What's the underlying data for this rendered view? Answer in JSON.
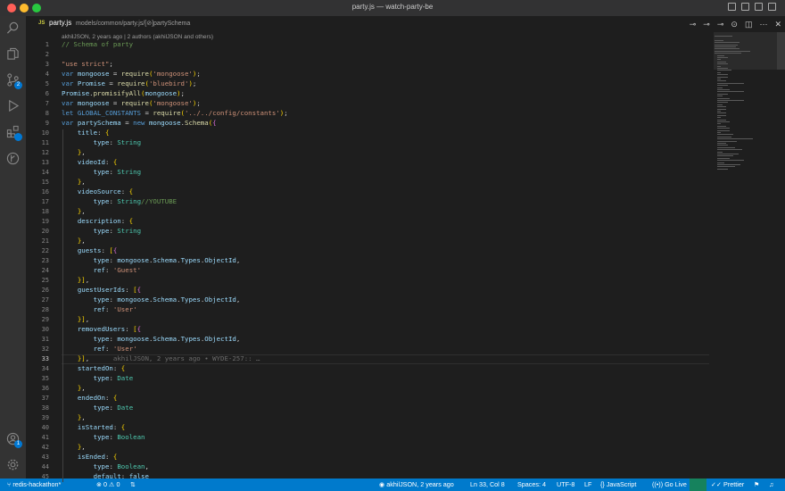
{
  "window": {
    "title": "party.js — watch-party-be"
  },
  "tab": {
    "lang": "JS",
    "filename": "party.js",
    "breadcrumb": "models/common/party.js/[⊘]partySchema"
  },
  "blame_header": "akhilJSON, 2 years ago | 2 authors (akhilJSON and others)",
  "activity_badges": {
    "scm": "2",
    "account": "1"
  },
  "code_lines": [
    {
      "n": "1",
      "text": "// Schema of party"
    },
    {
      "n": "2",
      "text": ""
    },
    {
      "n": "3",
      "text": "\"use strict\";"
    },
    {
      "n": "4",
      "text": "var mongoose = require('mongoose');"
    },
    {
      "n": "5",
      "text": "var Promise = require('bluebird');"
    },
    {
      "n": "6",
      "text": "Promise.promisifyAll(mongoose);"
    },
    {
      "n": "7",
      "text": "var mongoose = require('mongoose');"
    },
    {
      "n": "8",
      "text": "let GLOBAL_CONSTANTS = require('../../config/constants');"
    },
    {
      "n": "9",
      "text": "var partySchema = new mongoose.Schema({"
    },
    {
      "n": "10",
      "text": "    title: {"
    },
    {
      "n": "11",
      "text": "        type: String"
    },
    {
      "n": "12",
      "text": "    },"
    },
    {
      "n": "13",
      "text": "    videoId: {"
    },
    {
      "n": "14",
      "text": "        type: String"
    },
    {
      "n": "15",
      "text": "    },"
    },
    {
      "n": "16",
      "text": "    videoSource: {"
    },
    {
      "n": "17",
      "text": "        type: String//YOUTUBE"
    },
    {
      "n": "18",
      "text": "    },"
    },
    {
      "n": "19",
      "text": "    description: {"
    },
    {
      "n": "20",
      "text": "        type: String"
    },
    {
      "n": "21",
      "text": "    },"
    },
    {
      "n": "22",
      "text": "    guests: [{"
    },
    {
      "n": "23",
      "text": "        type: mongoose.Schema.Types.ObjectId,"
    },
    {
      "n": "24",
      "text": "        ref: 'Guest'"
    },
    {
      "n": "25",
      "text": "    }],"
    },
    {
      "n": "26",
      "text": "    guestUserIds: [{"
    },
    {
      "n": "27",
      "text": "        type: mongoose.Schema.Types.ObjectId,"
    },
    {
      "n": "28",
      "text": "        ref: 'User'"
    },
    {
      "n": "29",
      "text": "    }],"
    },
    {
      "n": "30",
      "text": "    removedUsers: [{"
    },
    {
      "n": "31",
      "text": "        type: mongoose.Schema.Types.ObjectId,"
    },
    {
      "n": "32",
      "text": "        ref: 'User'"
    },
    {
      "n": "33",
      "text": "    }],"
    },
    {
      "n": "34",
      "text": "    startedOn: {"
    },
    {
      "n": "35",
      "text": "        type: Date"
    },
    {
      "n": "36",
      "text": "    },"
    },
    {
      "n": "37",
      "text": "    endedOn: {"
    },
    {
      "n": "38",
      "text": "        type: Date"
    },
    {
      "n": "39",
      "text": "    },"
    },
    {
      "n": "40",
      "text": "    isStarted: {"
    },
    {
      "n": "41",
      "text": "        type: Boolean"
    },
    {
      "n": "42",
      "text": "    },"
    },
    {
      "n": "43",
      "text": "    isEnded: {"
    },
    {
      "n": "44",
      "text": "        type: Boolean,"
    },
    {
      "n": "45",
      "text": "        default: false"
    }
  ],
  "active_line": "33",
  "inline_blame": "akhilJSON, 2 years ago • WYDE-257:: …",
  "status": {
    "branch": "redis-hackathon*",
    "errors": "0",
    "warnings": "0",
    "blame": "akhilJSON, 2 years ago",
    "position": "Ln 33, Col 8",
    "spaces": "Spaces: 4",
    "encoding": "UTF-8",
    "eol": "LF",
    "language": "JavaScript",
    "golive": "Go Live",
    "prettier": "Prettier"
  },
  "colors": {
    "status_bar": "#007acc",
    "editor_bg": "#1e1e1e",
    "activity_bar": "#333333",
    "keyword": "#569cd6",
    "string": "#ce9178",
    "function": "#dcdcaa",
    "comment": "#6a9955",
    "variable": "#9cdcfe"
  }
}
